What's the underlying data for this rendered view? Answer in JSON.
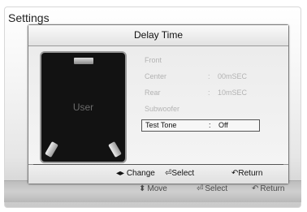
{
  "background": {
    "title": "Settings",
    "hints": [
      {
        "glyph": "⬍",
        "label": "Move"
      },
      {
        "glyph": "⏎",
        "label": "Select"
      },
      {
        "glyph": "↶",
        "label": "Return"
      }
    ]
  },
  "popup": {
    "title": "Delay Time",
    "graphic_label": "User",
    "items": [
      {
        "label": "Front",
        "sep": "",
        "value": ""
      },
      {
        "label": "Center",
        "sep": ":",
        "value": "00mSEC"
      },
      {
        "label": "Rear",
        "sep": ":",
        "value": "10mSEC"
      },
      {
        "label": "Subwoofer",
        "sep": "",
        "value": ""
      },
      {
        "label": "Test Tone",
        "sep": ":",
        "value": "Off"
      }
    ],
    "selected_index": 4,
    "footer": [
      {
        "glyph": "◂▸",
        "label": "Change"
      },
      {
        "glyph": "⏎",
        "label": "Select"
      },
      {
        "glyph": "↶",
        "label": "Return"
      }
    ]
  }
}
